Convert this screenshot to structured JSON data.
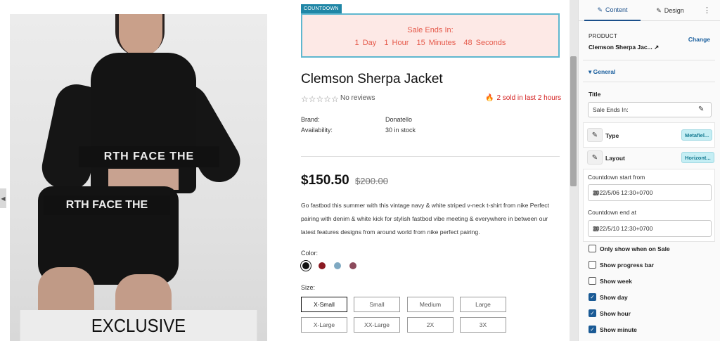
{
  "preview": {
    "image_caption": "EXCLUSIVE",
    "band_text": "RTH FACE  THE",
    "band_text_2": "RTH FACE  THE",
    "countdown": {
      "tag": "COUNTDOWN",
      "title": "Sale Ends In:",
      "day": "1 Day",
      "hour": "1 Hour",
      "minutes": "15 Minutes",
      "seconds": "48 Seconds"
    },
    "product": {
      "title": "Clemson Sherpa Jacket",
      "stars": "☆☆☆☆☆",
      "reviews": "No reviews",
      "sold": "2 sold in last 2 hours",
      "brand_label": "Brand:",
      "brand_value": "Donatello",
      "availability_label": "Availability:",
      "availability_value": "30 in stock",
      "price": "$150.50",
      "old_price": "$200.00",
      "description": "Go fastbod this summer with this vintage navy & white striped v-neck t-shirt from nike Perfect pairing with denim & white kick for stylish fastbod vibe meeting & everywhere in between our latest features designs from around world from nike perfect pairing.",
      "color_label": "Color:",
      "colors": [
        "#111111",
        "#8b1a22",
        "#7fa9c2",
        "#8c4a5c"
      ],
      "size_label": "Size:",
      "sizes": [
        "X-Small",
        "Small",
        "Medium",
        "Large",
        "X-Large",
        "XX-Large",
        "2X",
        "3X"
      ]
    }
  },
  "panel": {
    "tab_content": "Content",
    "tab_design": "Design",
    "product_label": "PRODUCT",
    "product_name": "Clemson Sherpa Jac...",
    "change": "Change",
    "general": "General",
    "title_label": "Title",
    "title_value": "Sale Ends In:",
    "type_label": "Type",
    "type_badge": "Metafiel...",
    "layout_label": "Layout",
    "layout_badge": "Horizont...",
    "start_label": "Countdown start from",
    "start_value": "2022/5/06 12:30+0700",
    "end_label": "Countdown end at",
    "end_value": "2022/5/10 12:30+0700",
    "options": [
      {
        "label": "Only show when on Sale",
        "checked": false
      },
      {
        "label": "Show progress bar",
        "checked": false
      },
      {
        "label": "Show week",
        "checked": false
      },
      {
        "label": "Show day",
        "checked": true
      },
      {
        "label": "Show hour",
        "checked": true
      },
      {
        "label": "Show minute",
        "checked": true
      }
    ]
  },
  "colors": {
    "accent": "#1a5f9e",
    "countdown_text": "#e5594a",
    "countdown_bg": "#fde9e6",
    "sold_red": "#d42020"
  }
}
